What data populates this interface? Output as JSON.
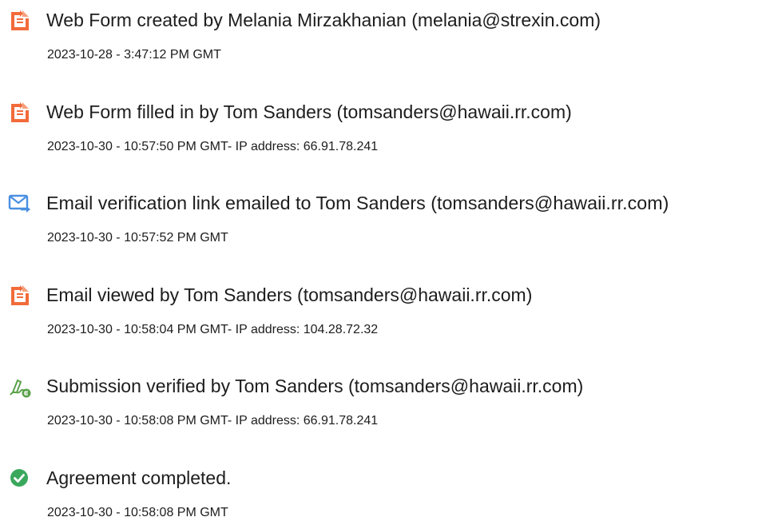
{
  "events": [
    {
      "icon": "document-icon",
      "title": "Web Form created by Melania Mirzakhanian (melania@strexin.com)",
      "meta": "2023-10-28 - 3:47:12 PM GMT"
    },
    {
      "icon": "document-icon",
      "title": "Web Form filled in by Tom Sanders (tomsanders@hawaii.rr.com)",
      "meta": "2023-10-30 - 10:57:50 PM GMT- IP address: 66.91.78.241"
    },
    {
      "icon": "email-sent-icon",
      "title": "Email verification link emailed to Tom Sanders (tomsanders@hawaii.rr.com)",
      "meta": "2023-10-30 - 10:57:52 PM GMT"
    },
    {
      "icon": "document-icon",
      "title": "Email viewed by Tom Sanders (tomsanders@hawaii.rr.com)",
      "meta": "2023-10-30 - 10:58:04 PM GMT- IP address: 104.28.72.32"
    },
    {
      "icon": "signature-verified-icon",
      "title": "Submission verified by Tom Sanders (tomsanders@hawaii.rr.com)",
      "meta": "2023-10-30 - 10:58:08 PM GMT- IP address: 66.91.78.241"
    },
    {
      "icon": "checkmark-circle-icon",
      "title": "Agreement completed.",
      "meta": "2023-10-30 - 10:58:08 PM GMT"
    }
  ],
  "colors": {
    "document_icon": "#f26b3a",
    "email_icon": "#4a90e2",
    "signature_icon": "#5aa14a",
    "check_icon": "#3aa85c"
  }
}
